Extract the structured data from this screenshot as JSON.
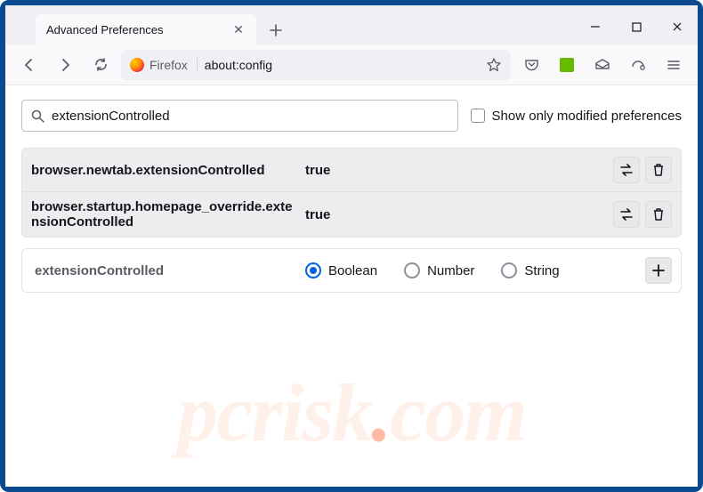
{
  "tab": {
    "title": "Advanced Preferences"
  },
  "urlbar": {
    "prefix": "Firefox",
    "url": "about:config"
  },
  "filter": {
    "value": "extensionControlled",
    "showOnlyLabel": "Show only modified preferences"
  },
  "prefs": [
    {
      "name": "browser.newtab.extensionControlled",
      "value": "true"
    },
    {
      "name": "browser.startup.homepage_override.extensionControlled",
      "value": "true"
    }
  ],
  "newPref": {
    "name": "extensionControlled",
    "types": {
      "boolean": "Boolean",
      "number": "Number",
      "string": "String"
    }
  },
  "watermark": {
    "a": "pcrisk",
    "b": ".",
    "c": "com"
  }
}
